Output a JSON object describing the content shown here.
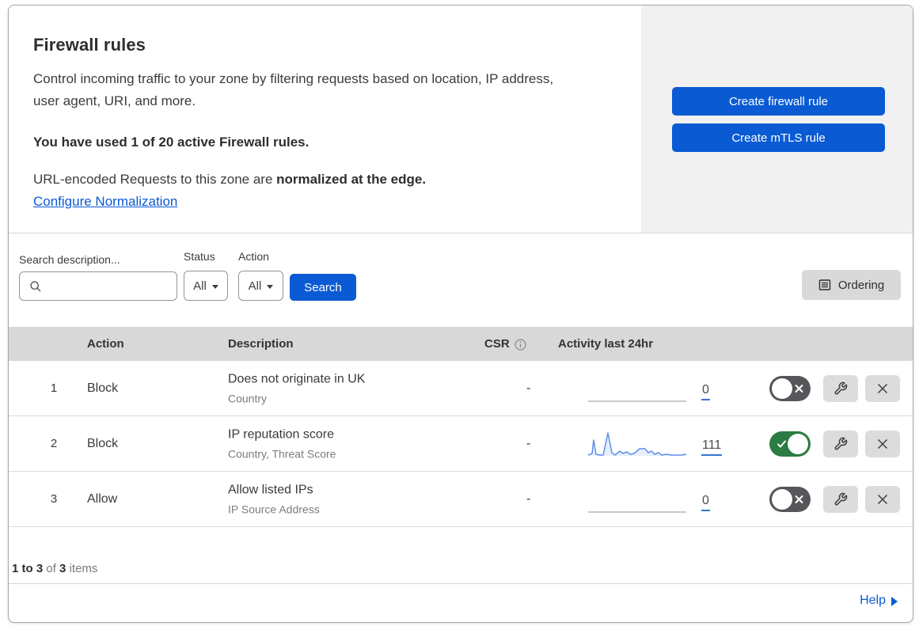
{
  "header": {
    "title": "Firewall rules",
    "description_lines": [
      "Control incoming traffic to your zone by filtering requests based on location, IP address,",
      "user agent, URI, and more."
    ],
    "usage_text": "You have used 1 of 20 active Firewall rules.",
    "normalization_prefix": "URL-encoded Requests to this zone are ",
    "normalization_bold": "normalized at the edge.",
    "configure_link": "Configure Normalization",
    "create_firewall_button": "Create firewall rule",
    "create_mtls_button": "Create mTLS rule"
  },
  "filters": {
    "search_label": "Search description...",
    "status_label": "Status",
    "status_value": "All",
    "action_label": "Action",
    "action_value": "All",
    "search_button": "Search",
    "ordering_button": "Ordering"
  },
  "table": {
    "columns": {
      "action": "Action",
      "description": "Description",
      "csr": "CSR",
      "activity": "Activity last 24hr"
    },
    "rows": [
      {
        "num": "1",
        "action": "Block",
        "title": "Does not originate in UK",
        "subtitle": "Country",
        "csr": "-",
        "count": "0",
        "activity": "flat",
        "enabled": false
      },
      {
        "num": "2",
        "action": "Block",
        "title": "IP reputation score",
        "subtitle": "Country, Threat Score",
        "csr": "-",
        "count": "111",
        "activity": "spark",
        "enabled": true
      },
      {
        "num": "3",
        "action": "Allow",
        "title": "Allow listed IPs",
        "subtitle": "IP Source Address",
        "csr": "-",
        "count": "0",
        "activity": "flat",
        "enabled": false
      }
    ],
    "summary": {
      "range": "1 to 3",
      "of": "of",
      "total": "3",
      "items": "items"
    }
  },
  "chart_data": {
    "type": "line",
    "title": "Activity last 24hr sparkline (rule 2)",
    "x_range": [
      0,
      124
    ],
    "y_range": [
      0,
      32
    ],
    "points": [
      [
        0,
        29
      ],
      [
        5,
        27
      ],
      [
        7,
        10
      ],
      [
        10,
        28
      ],
      [
        14,
        29
      ],
      [
        19,
        29
      ],
      [
        25,
        1
      ],
      [
        30,
        26
      ],
      [
        34,
        29
      ],
      [
        40,
        24
      ],
      [
        44,
        27
      ],
      [
        49,
        25
      ],
      [
        53,
        28
      ],
      [
        58,
        27
      ],
      [
        65,
        21
      ],
      [
        72,
        21
      ],
      [
        76,
        26
      ],
      [
        80,
        24
      ],
      [
        84,
        28
      ],
      [
        89,
        26
      ],
      [
        93,
        29
      ],
      [
        99,
        28
      ],
      [
        105,
        29
      ],
      [
        112,
        29
      ],
      [
        118,
        29
      ],
      [
        124,
        28
      ]
    ],
    "line_color": "#5f8fe8",
    "fill_color": "rgba(95,143,232,0.15)"
  },
  "footer": {
    "help": "Help"
  },
  "colors": {
    "primary_blue": "#0a5bd3",
    "toggle_on_green": "#2b7c43",
    "toggle_off_gray": "#56575b",
    "header_gray": "#d8d8d8",
    "panel_gray": "#f1f1f1"
  }
}
